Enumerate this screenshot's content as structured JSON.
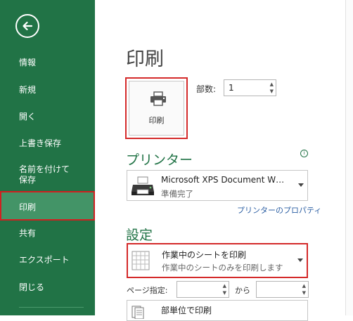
{
  "sidebar": {
    "back_icon": "back-arrow-icon",
    "items": [
      {
        "label": "情報"
      },
      {
        "label": "新規"
      },
      {
        "label": "開く"
      },
      {
        "label": "上書き保存"
      },
      {
        "label": "名前を付けて\n保存"
      },
      {
        "label": "印刷"
      },
      {
        "label": "共有"
      },
      {
        "label": "エクスポート"
      },
      {
        "label": "閉じる"
      }
    ]
  },
  "main": {
    "title": "印刷",
    "print_button_label": "印刷",
    "copies_label": "部数:",
    "copies_value": "1",
    "printer_section": "プリンター",
    "printer": {
      "name": "Microsoft XPS Document W…",
      "status": "準備完了"
    },
    "printer_properties_link": "プリンターのプロパティ",
    "settings_section": "設定",
    "print_what": {
      "title": "作業中のシートを印刷",
      "description": "作業中のシートのみを印刷します"
    },
    "pages_label": "ページ指定:",
    "pages_to": "から",
    "collation": {
      "title": "部単位で印刷"
    }
  },
  "colors": {
    "accent": "#217346",
    "sidebar_selected": "#439467",
    "highlight_border": "#d42a2a"
  }
}
